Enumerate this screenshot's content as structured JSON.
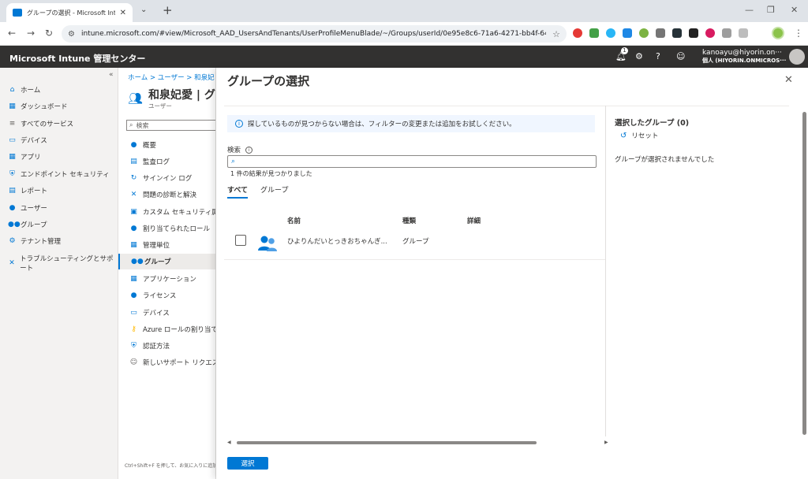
{
  "browser": {
    "tab_title": "グループの選択 - Microsoft Intune",
    "url": "intune.microsoft.com/#view/Microsoft_AAD_UsersAndTenants/UserProfileMenuBlade/~/Groups/userId/0e95e8c6-71a6-4271-bb4f-645b81a..."
  },
  "header": {
    "title": "Microsoft Intune 管理センター",
    "notification_count": "1",
    "account_email": "kanoayu@hiyorin.on···",
    "account_tenant": "個人 (HIYORIN.ONMICROS···"
  },
  "leftnav": {
    "items": [
      {
        "label": "ホーム",
        "icon": "home-icon"
      },
      {
        "label": "ダッシュボード",
        "icon": "dashboard-icon"
      },
      {
        "label": "すべてのサービス",
        "icon": "list-icon"
      },
      {
        "label": "デバイス",
        "icon": "device-icon"
      },
      {
        "label": "アプリ",
        "icon": "apps-icon"
      },
      {
        "label": "エンドポイント セキュリティ",
        "icon": "shield-icon"
      },
      {
        "label": "レポート",
        "icon": "report-icon"
      },
      {
        "label": "ユーザー",
        "icon": "user-icon"
      },
      {
        "label": "グループ",
        "icon": "group-icon"
      },
      {
        "label": "テナント管理",
        "icon": "gear-icon"
      },
      {
        "label": "トラブルシューティングとサポート",
        "icon": "wrench-icon"
      }
    ]
  },
  "userblade": {
    "breadcrumb": "ホーム > ユーザー > 和泉妃",
    "title": "和泉妃愛 | グ",
    "subtitle": "ユーザー",
    "search_placeholder": "検索",
    "items": [
      {
        "label": "概要"
      },
      {
        "label": "監査ログ"
      },
      {
        "label": "サインイン ログ"
      },
      {
        "label": "問題の診断と解決"
      },
      {
        "label": "カスタム セキュリティ属性"
      },
      {
        "label": "割り当てられたロール"
      },
      {
        "label": "管理単位"
      },
      {
        "label": "グループ"
      },
      {
        "label": "アプリケーション"
      },
      {
        "label": "ライセンス"
      },
      {
        "label": "デバイス"
      },
      {
        "label": "Azure ロールの割り当て"
      },
      {
        "label": "認証方法"
      },
      {
        "label": "新しいサポート リクエスト"
      }
    ],
    "footer": "Ctrl+Shift+F を押して、お気に入りに追加"
  },
  "panel": {
    "title": "グループの選択",
    "info_text": "探しているものが見つからない場合は、フィルターの変更または追加をお試しください。",
    "search_label": "検索",
    "result_count": "1 件の結果が見つかりました",
    "tabs": [
      "すべて",
      "グループ"
    ],
    "columns": {
      "name": "名前",
      "type": "種類",
      "details": "詳細"
    },
    "rows": [
      {
        "name": "ひよりんだいとっきおちゃんぎ...",
        "type": "グループ",
        "details": ""
      }
    ],
    "selected_title": "選択したグループ (0)",
    "reset_label": "リセット",
    "no_selection": "グループが選択されませんでした",
    "select_button": "選択"
  },
  "colors": {
    "accent": "#0078d4",
    "header_bg": "#323130"
  }
}
